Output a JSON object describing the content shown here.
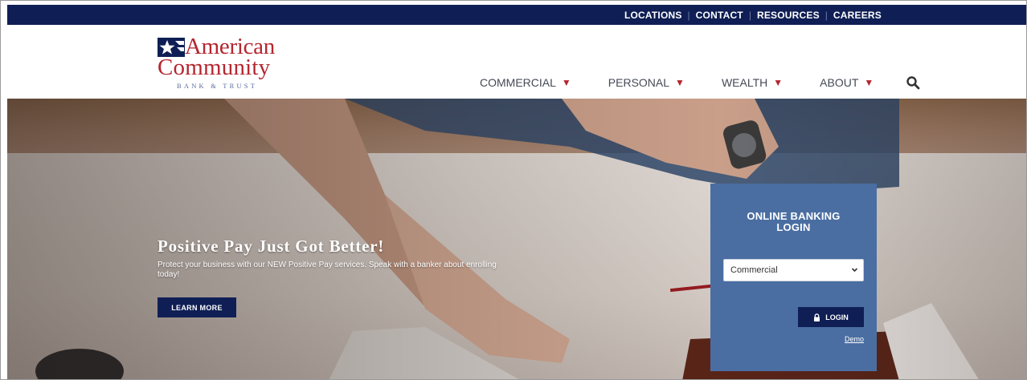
{
  "topbar": {
    "links": [
      "LOCATIONS",
      "CONTACT",
      "RESOURCES",
      "CAREERS"
    ]
  },
  "logo": {
    "line1": "American",
    "line2": "Community",
    "line3": "BANK & TRUST",
    "colors": {
      "red": "#b4262f",
      "navy": "#0f1f55"
    }
  },
  "nav": {
    "items": [
      {
        "label": "COMMERCIAL",
        "caret": "▼"
      },
      {
        "label": "PERSONAL",
        "caret": "▼"
      },
      {
        "label": "WEALTH",
        "caret": "▼"
      },
      {
        "label": "ABOUT",
        "caret": "▼"
      }
    ],
    "search_icon": "search-icon"
  },
  "hero": {
    "title": "Positive Pay Just Got Better!",
    "subtitle": "Protect your business with our NEW Positive Pay services. Speak with a banker about enrolling today!",
    "button": "LEARN MORE"
  },
  "login": {
    "title_line1": "ONLINE BANKING",
    "title_line2": "LOGIN",
    "select_value": "Commercial",
    "button": "LOGIN",
    "demo": "Demo"
  },
  "colors": {
    "navy": "#0f1f55",
    "login_panel": "#4a6ea2",
    "accent_red": "#b4262f"
  }
}
